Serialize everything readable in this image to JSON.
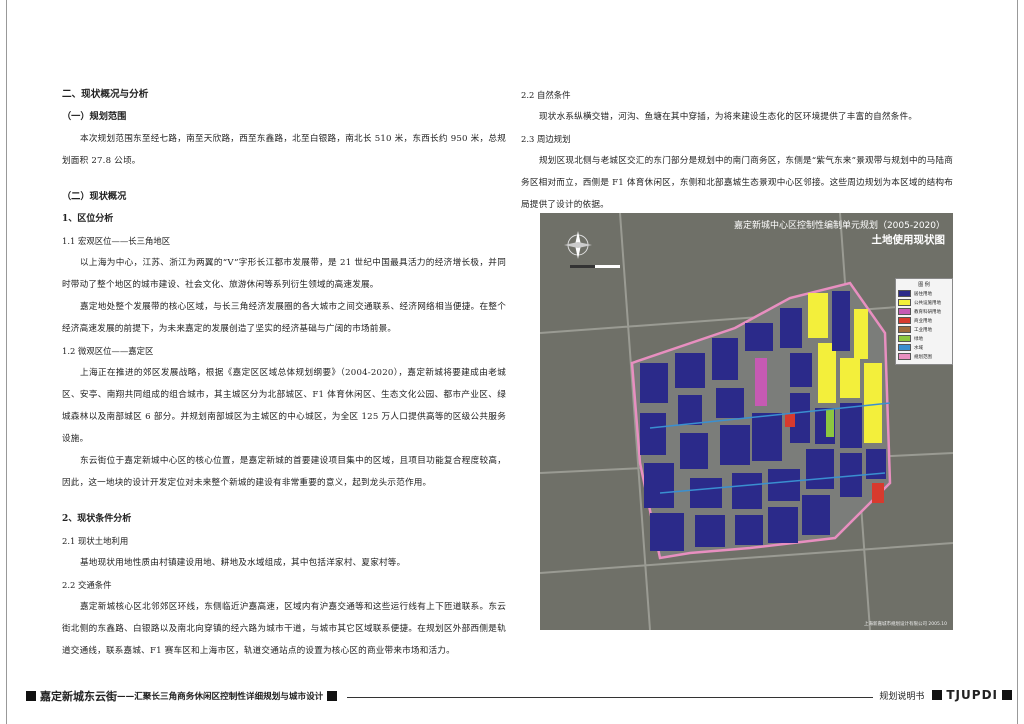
{
  "left_column": [
    {
      "kind": "h1",
      "text": "二、现状概况与分析"
    },
    {
      "kind": "h2",
      "text": "（一）规划范围"
    },
    {
      "kind": "para",
      "text": "本次规划范围东至经七路，南至天欣路，西至东鑫路，北至白银路，南北长 510 米，东西长约 950 米，总规划面积 27.8 公顷。"
    },
    {
      "kind": "spacer"
    },
    {
      "kind": "h2",
      "text": "（二）现状概况"
    },
    {
      "kind": "h3",
      "text": "1、区位分析"
    },
    {
      "kind": "h4",
      "text": "1.1 宏观区位——长三角地区"
    },
    {
      "kind": "para",
      "text": "以上海为中心，江苏、浙江为两翼的“V”字形长江都市发展带，是 21 世纪中国最具活力的经济增长极，并同时带动了整个地区的城市建设、社会文化、旅游休闲等系列衍生领域的高速发展。"
    },
    {
      "kind": "para",
      "text": "嘉定地处整个发展带的核心区域，与长三角经济发展圈的各大城市之间交通联系、经济网络相当便捷。在整个经济高速发展的前提下，为未来嘉定的发展创造了坚实的经济基础与广阔的市场前景。"
    },
    {
      "kind": "h4",
      "text": "1.2 微观区位——嘉定区"
    },
    {
      "kind": "para",
      "text": "上海正在推进的郊区发展战略，根据《嘉定区区域总体规划纲要》（2004-2020），嘉定新城将要建成由老城区、安亭、南翔共同组成的组合城市，其主城区分为北部城区、F1 体育休闲区、生态文化公园、都市产业区、绿城森林以及南部城区 6 部分。并规划南部城区为主城区的中心城区，为全区 125 万人口提供高等的区级公共服务设施。"
    },
    {
      "kind": "para",
      "text": "东云街位于嘉定新城中心区的核心位置，是嘉定新城的首要建设项目集中的区域，且项目功能复合程度较高，因此，这一地块的设计开发定位对未来整个新城的建设有非常重要的意义，起到龙头示范作用。"
    },
    {
      "kind": "spacer"
    },
    {
      "kind": "h3",
      "text": "2、现状条件分析"
    },
    {
      "kind": "h4",
      "text": "2.1 现状土地利用"
    },
    {
      "kind": "para",
      "text": "基地现状用地性质由村镇建设用地、耕地及水域组成，其中包括洋家村、夏家村等。"
    },
    {
      "kind": "h4",
      "text": "2.2 交通条件"
    },
    {
      "kind": "para",
      "text": "嘉定新城核心区北邻郊区环线，东侧临近沪嘉高速，区域内有沪嘉交通等和这些运行线有上下匝道联系。东云街北侧的东鑫路、白银路以及南北向穿镇的经六路为城市干道，与城市其它区域联系便捷。在规划区外部西侧是轨道交通线，联系嘉城、F1 赛车区和上海市区，轨道交通站点的设置为核心区的商业带来市场和活力。"
    }
  ],
  "right_column": [
    {
      "kind": "h4",
      "text": "2.2 自然条件"
    },
    {
      "kind": "para",
      "text": "现状水系纵横交错，河沟、鱼塘在其中穿插，为将来建设生态化的区环境提供了丰富的自然条件。"
    },
    {
      "kind": "h4",
      "text": "2.3 周边规划"
    },
    {
      "kind": "para",
      "text": "规划区现北侧与老城区交汇的东门部分是规划中的南门商务区，东侧是“紫气东来”景观带与规划中的马陆商务区相对而立，西侧是 F1 体育休闲区，东侧和北部嘉城生态景观中心区邻接。这些周边规划为本区域的结构布局提供了设计的依据。"
    }
  ],
  "map": {
    "title_line1": "嘉定新城中心区控制性编制单元规划（2005-2020）",
    "title_line2": "土地使用现状图",
    "legend_title": "图 例",
    "legend": [
      {
        "label": "居住用地",
        "color": "#2b2a8a"
      },
      {
        "label": "公共设施用地",
        "color": "#f3ef3b"
      },
      {
        "label": "教育科研用地",
        "color": "#c65ab3"
      },
      {
        "label": "商业用地",
        "color": "#d73a2e"
      },
      {
        "label": "工业用地",
        "color": "#9e6a3c"
      },
      {
        "label": "绿地",
        "color": "#8cc63f"
      },
      {
        "label": "水域",
        "color": "#3a8fd0"
      },
      {
        "label": "规划范围",
        "color": "#e88fc0"
      }
    ],
    "credit": "上海新嘉城市规划设计有限公司  2005.10"
  },
  "footer": {
    "title": "嘉定新城东云街",
    "subtitle": "——汇聚长三角商务休闲区控制性详细规划与城市设计",
    "doc_type": "规划说明书",
    "logo": "TJUPDI"
  }
}
